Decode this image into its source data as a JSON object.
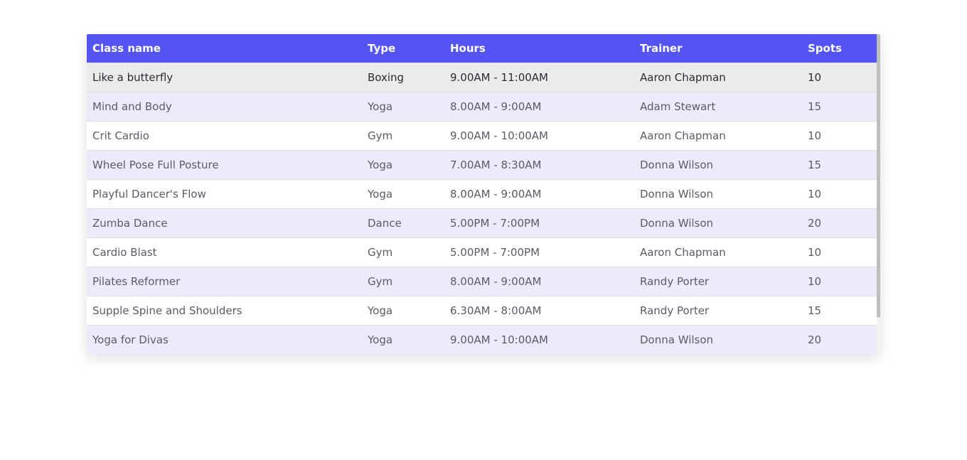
{
  "colors": {
    "header_bg": "#5454f2",
    "header_text": "#ffffff",
    "row_hover_bg": "#ebebeb",
    "row_alt_bg": "#efeafa",
    "row_bg": "#ffffff",
    "scrollbar_thumb": "#bdbdbd"
  },
  "table": {
    "columns": [
      "Class name",
      "Type",
      "Hours",
      "Trainer",
      "Spots"
    ],
    "rows": [
      {
        "class_name": "Like a butterfly",
        "type": "Boxing",
        "hours": "9.00AM - 11:00AM",
        "trainer": "Aaron Chapman",
        "spots": "10",
        "state": "hover"
      },
      {
        "class_name": "Mind and Body",
        "type": "Yoga",
        "hours": "8.00AM - 9:00AM",
        "trainer": "Adam Stewart",
        "spots": "15",
        "state": "alt"
      },
      {
        "class_name": "Crit Cardio",
        "type": "Gym",
        "hours": "9.00AM - 10:00AM",
        "trainer": "Aaron Chapman",
        "spots": "10",
        "state": "plain"
      },
      {
        "class_name": "Wheel Pose Full Posture",
        "type": "Yoga",
        "hours": "7.00AM - 8:30AM",
        "trainer": "Donna Wilson",
        "spots": "15",
        "state": "alt"
      },
      {
        "class_name": "Playful Dancer's Flow",
        "type": "Yoga",
        "hours": "8.00AM - 9:00AM",
        "trainer": "Donna Wilson",
        "spots": "10",
        "state": "plain"
      },
      {
        "class_name": "Zumba Dance",
        "type": "Dance",
        "hours": "5.00PM - 7:00PM",
        "trainer": "Donna Wilson",
        "spots": "20",
        "state": "alt"
      },
      {
        "class_name": "Cardio Blast",
        "type": "Gym",
        "hours": "5.00PM - 7:00PM",
        "trainer": "Aaron Chapman",
        "spots": "10",
        "state": "plain"
      },
      {
        "class_name": "Pilates Reformer",
        "type": "Gym",
        "hours": "8.00AM - 9:00AM",
        "trainer": "Randy Porter",
        "spots": "10",
        "state": "alt"
      },
      {
        "class_name": "Supple Spine and Shoulders",
        "type": "Yoga",
        "hours": "6.30AM - 8:00AM",
        "trainer": "Randy Porter",
        "spots": "15",
        "state": "plain"
      },
      {
        "class_name": "Yoga for Divas",
        "type": "Yoga",
        "hours": "9.00AM - 10:00AM",
        "trainer": "Donna Wilson",
        "spots": "20",
        "state": "alt"
      }
    ]
  }
}
